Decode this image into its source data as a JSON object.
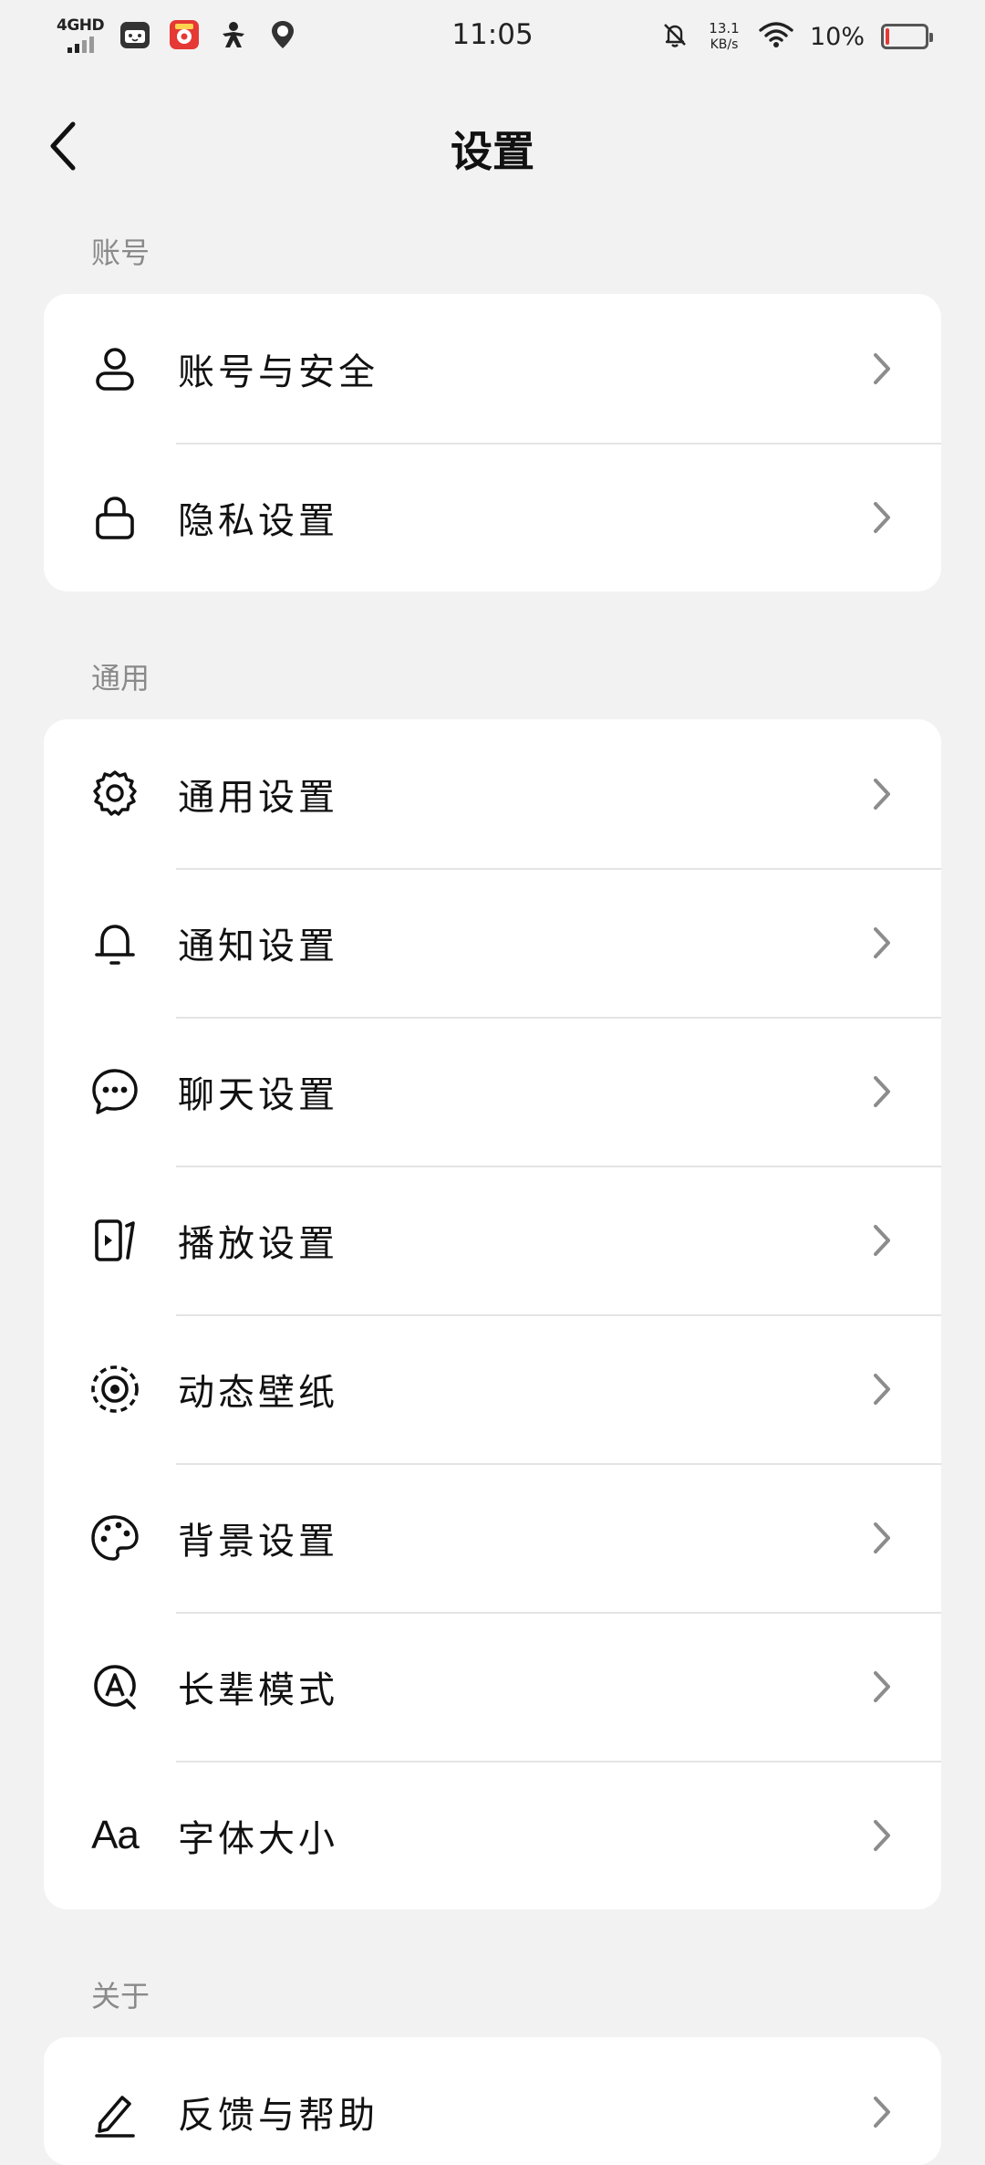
{
  "status_bar": {
    "network": "4GHD",
    "time": "11:05",
    "speed_value": "13.1",
    "speed_unit": "KB/s",
    "battery_percent": "10%",
    "battery_level": 0.1,
    "icons": [
      "signal-icon",
      "app-icon-cat",
      "app-icon-red",
      "app-icon-person",
      "app-icon-location",
      "mute-bell-icon",
      "wifi-icon",
      "battery-icon"
    ]
  },
  "header": {
    "title": "设置",
    "back_icon": "chevron-left-icon"
  },
  "sections": {
    "account": {
      "label": "账号",
      "items": [
        {
          "label": "账号与安全",
          "icon": "user-icon"
        },
        {
          "label": "隐私设置",
          "icon": "lock-icon"
        }
      ]
    },
    "general": {
      "label": "通用",
      "items": [
        {
          "label": "通用设置",
          "icon": "gear-icon"
        },
        {
          "label": "通知设置",
          "icon": "bell-icon"
        },
        {
          "label": "聊天设置",
          "icon": "chat-bubble-icon"
        },
        {
          "label": "播放设置",
          "icon": "play-screen-icon"
        },
        {
          "label": "动态壁纸",
          "icon": "live-wallpaper-icon"
        },
        {
          "label": "背景设置",
          "icon": "palette-icon"
        },
        {
          "label": "长辈模式",
          "icon": "elder-mode-icon"
        },
        {
          "label": "字体大小",
          "icon": "font-size-icon",
          "icon_text": "Aa"
        }
      ]
    },
    "about": {
      "label": "关于",
      "items": [
        {
          "label": "反馈与帮助",
          "icon": "pencil-icon"
        }
      ]
    }
  },
  "colors": {
    "background": "#f2f2f2",
    "card": "#ffffff",
    "section_label": "#8a8a8a",
    "chevron": "#8c8c8c",
    "battery_low": "#e53935"
  }
}
